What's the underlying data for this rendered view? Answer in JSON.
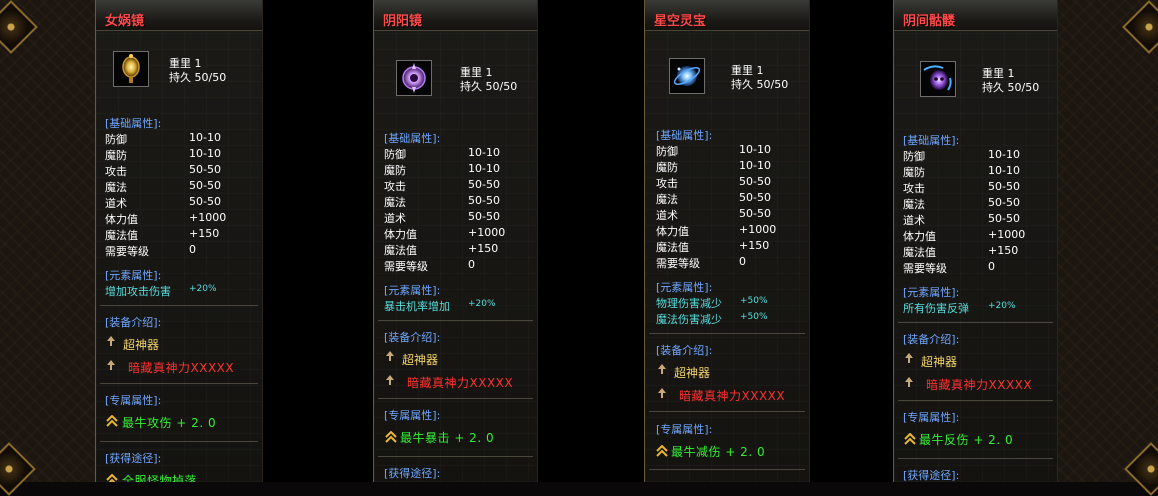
{
  "labels": {
    "weight": "重里",
    "durability": "持久",
    "base_header": "[基础属性]:",
    "element_header": "[元素属性]:",
    "equip_header": "[装备介绍]:",
    "exclusive_header": "[专属属性]:",
    "obtain_header": "[获得途径]:"
  },
  "base_stats": [
    {
      "name": "防御",
      "value": "10-10"
    },
    {
      "name": "魔防",
      "value": "10-10"
    },
    {
      "name": "攻击",
      "value": "50-50"
    },
    {
      "name": "魔法",
      "value": "50-50"
    },
    {
      "name": "道术",
      "value": "50-50"
    },
    {
      "name": "体力值",
      "value": "+1000"
    },
    {
      "name": "魔法值",
      "value": "+150"
    },
    {
      "name": "需要等级",
      "value": "0"
    }
  ],
  "equip_intro": {
    "line1": "超神器",
    "line2": "暗藏真神力XXXXX"
  },
  "items": [
    {
      "title": "女娲镜",
      "weight": "1",
      "durability": "50/50",
      "icon": "golden-mirror-icon",
      "element_stats": [
        {
          "name": "增加攻击伤害",
          "value": "+20%"
        }
      ],
      "exclusive": "最牛攻伤 + 2. 0",
      "obtain": "全服怪物掉落"
    },
    {
      "title": "阴阳镜",
      "weight": "1",
      "durability": "50/50",
      "icon": "purple-orb-mirror-icon",
      "element_stats": [
        {
          "name": "暴击机率增加",
          "value": "+20%"
        }
      ],
      "exclusive": "最牛暴击 + 2. 0",
      "obtain": ""
    },
    {
      "title": "星空灵宝",
      "weight": "1",
      "durability": "50/50",
      "icon": "blue-star-orb-icon",
      "element_stats": [
        {
          "name": "物理伤害减少",
          "value": "+50%"
        },
        {
          "name": "魔法伤害减少",
          "value": "+50%"
        }
      ],
      "exclusive": "最牛减伤 + 2. 0",
      "obtain": ""
    },
    {
      "title": "阴间骷髅",
      "weight": "1",
      "durability": "50/50",
      "icon": "purple-skull-icon",
      "element_stats": [
        {
          "name": "所有伤害反弹",
          "value": "+20%"
        }
      ],
      "exclusive": "最牛反伤 + 2. 0",
      "obtain": ""
    }
  ],
  "colors": {
    "title": "#ff4a4a",
    "header": "#6fa6ff",
    "element": "#56dede",
    "intro_gold": "#f2d36c",
    "intro_red": "#ff3030",
    "exclusive_green": "#33ee33"
  }
}
